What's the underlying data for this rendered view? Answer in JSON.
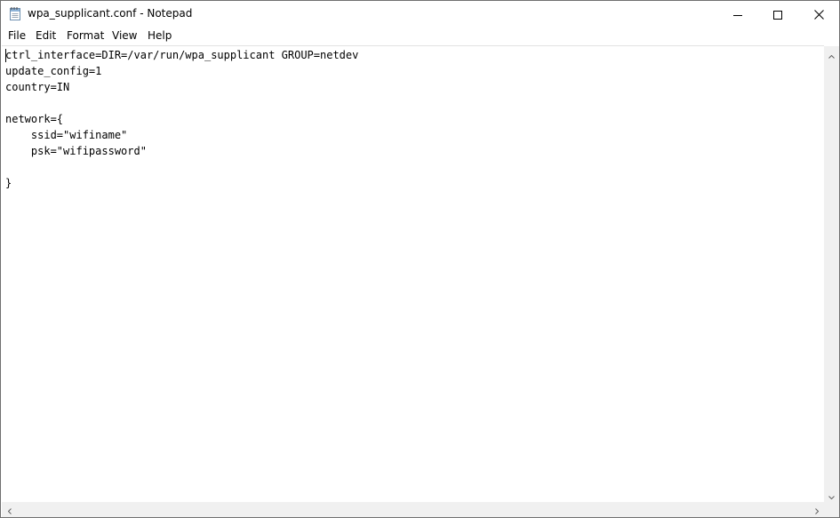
{
  "window": {
    "title": "wpa_supplicant.conf - Notepad",
    "app_icon": "notepad-icon"
  },
  "caption_buttons": {
    "minimize_icon": "minimize-icon",
    "maximize_icon": "maximize-icon",
    "close_icon": "close-icon"
  },
  "menu": {
    "items": [
      {
        "label": "File"
      },
      {
        "label": "Edit"
      },
      {
        "label": "Format"
      },
      {
        "label": "View"
      },
      {
        "label": "Help"
      }
    ]
  },
  "editor": {
    "content": "ctrl_interface=DIR=/var/run/wpa_supplicant GROUP=netdev\nupdate_config=1\ncountry=IN\n\nnetwork={\n    ssid=\"wifiname\"\n    psk=\"wifipassword\"\n\n}"
  },
  "scrollbars": {
    "up_icon": "chevron-up-icon",
    "down_icon": "chevron-down-icon",
    "left_icon": "chevron-left-icon",
    "right_icon": "chevron-right-icon"
  },
  "colors": {
    "window_border": "#707070",
    "scrollbar_bg": "#f0f0f0",
    "text": "#000000",
    "background": "#ffffff"
  }
}
